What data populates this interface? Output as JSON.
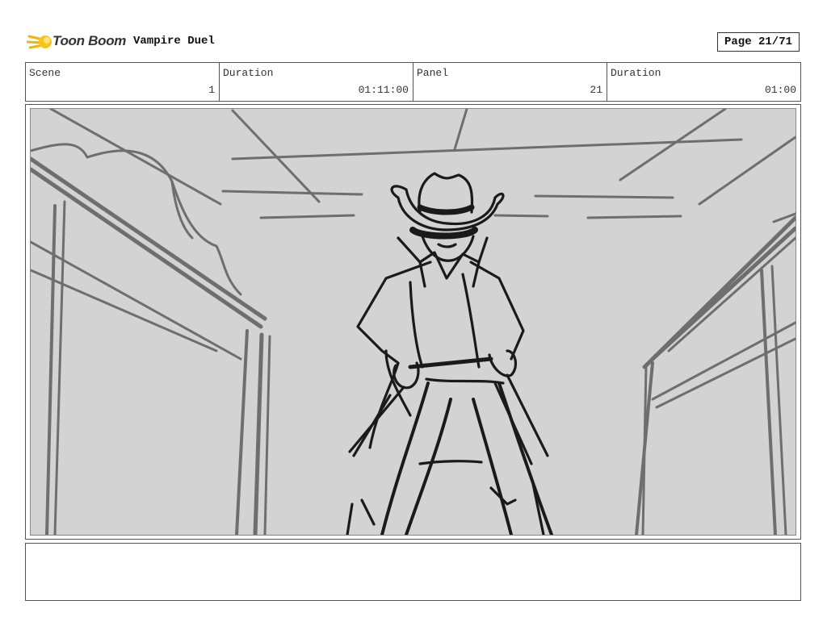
{
  "header": {
    "logo_text": "Toon Boom",
    "project_title": "Vampire Duel",
    "page_label": "Page 21/71"
  },
  "info": {
    "scene_label": "Scene",
    "scene_value": "1",
    "scene_duration_label": "Duration",
    "scene_duration_value": "01:11:00",
    "panel_label": "Panel",
    "panel_value": "21",
    "panel_duration_label": "Duration",
    "panel_duration_value": "01:00"
  },
  "panel": {
    "background_color": "#d3d3d3",
    "sketch_color": "#1a1a1a",
    "environment_color": "#6e6e6e"
  },
  "notes": {
    "text": ""
  }
}
